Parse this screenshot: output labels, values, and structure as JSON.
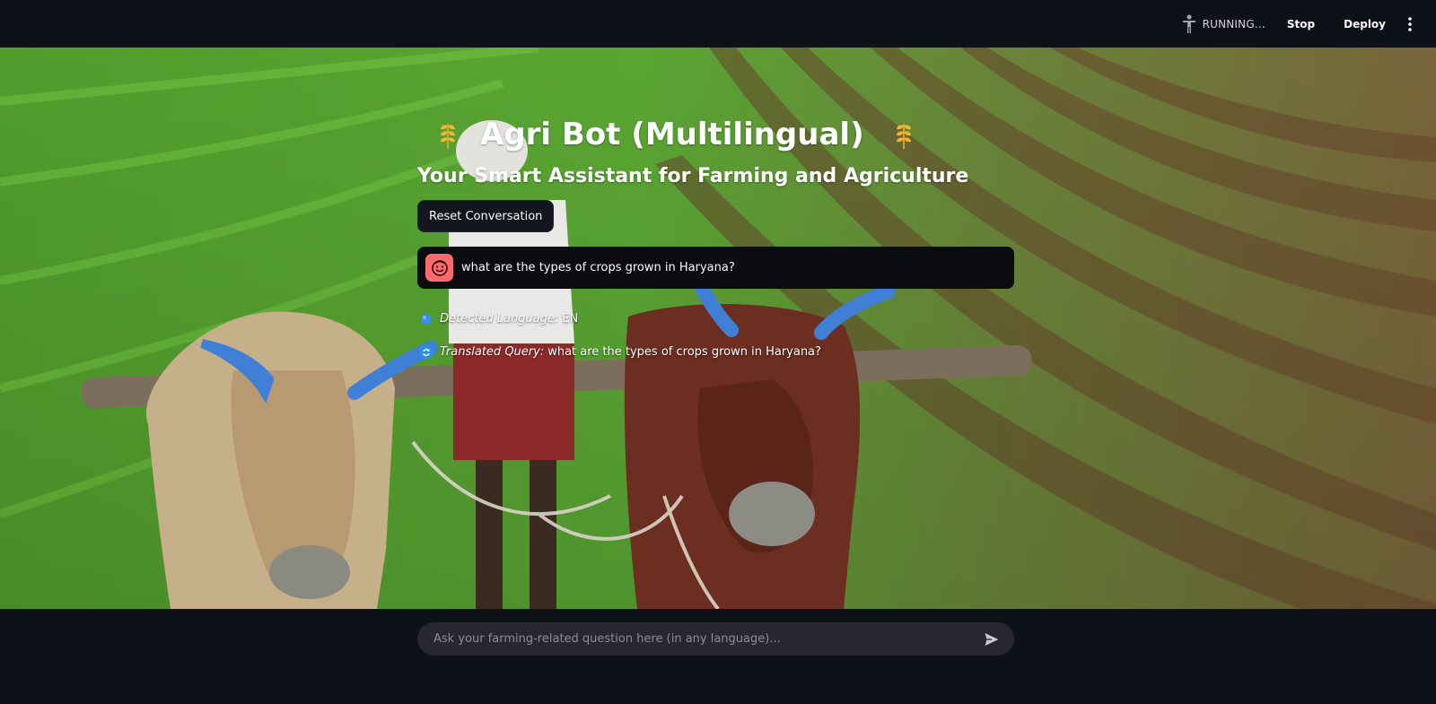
{
  "toolbar": {
    "status_text": "RUNNING...",
    "stop_label": "Stop",
    "deploy_label": "Deploy",
    "status_icon": "running-figure-icon",
    "menu_icon": "vertical-dots-icon"
  },
  "header": {
    "title": "Agri Bot (Multilingual)",
    "title_icon": "wheat-icon",
    "subtitle": "Your Smart Assistant for Farming and Agriculture"
  },
  "actions": {
    "reset_label": "Reset Conversation"
  },
  "chat": {
    "messages": [
      {
        "role": "user",
        "avatar_icon": "smiley-face-icon",
        "text": "what are the types of crops grown in Haryana?"
      }
    ],
    "detected_language": {
      "icon": "blue-circle-icon",
      "label": "Detected Language:",
      "value": "EN"
    },
    "translated_query": {
      "icon": "refresh-arrows-icon",
      "label": "Translated Query:",
      "value": "what are the types of crops grown in Haryana?"
    }
  },
  "input": {
    "placeholder": "Ask your farming-related question here (in any language)...",
    "value": "",
    "send_icon": "send-arrow-icon"
  },
  "colors": {
    "app_background": "#0e1117",
    "input_background": "#262730",
    "avatar_background": "#ff6b6b",
    "message_background": "#0b0c10",
    "field_green": "#4f9a2c",
    "ox_horn_blue": "#3f7fd6"
  }
}
